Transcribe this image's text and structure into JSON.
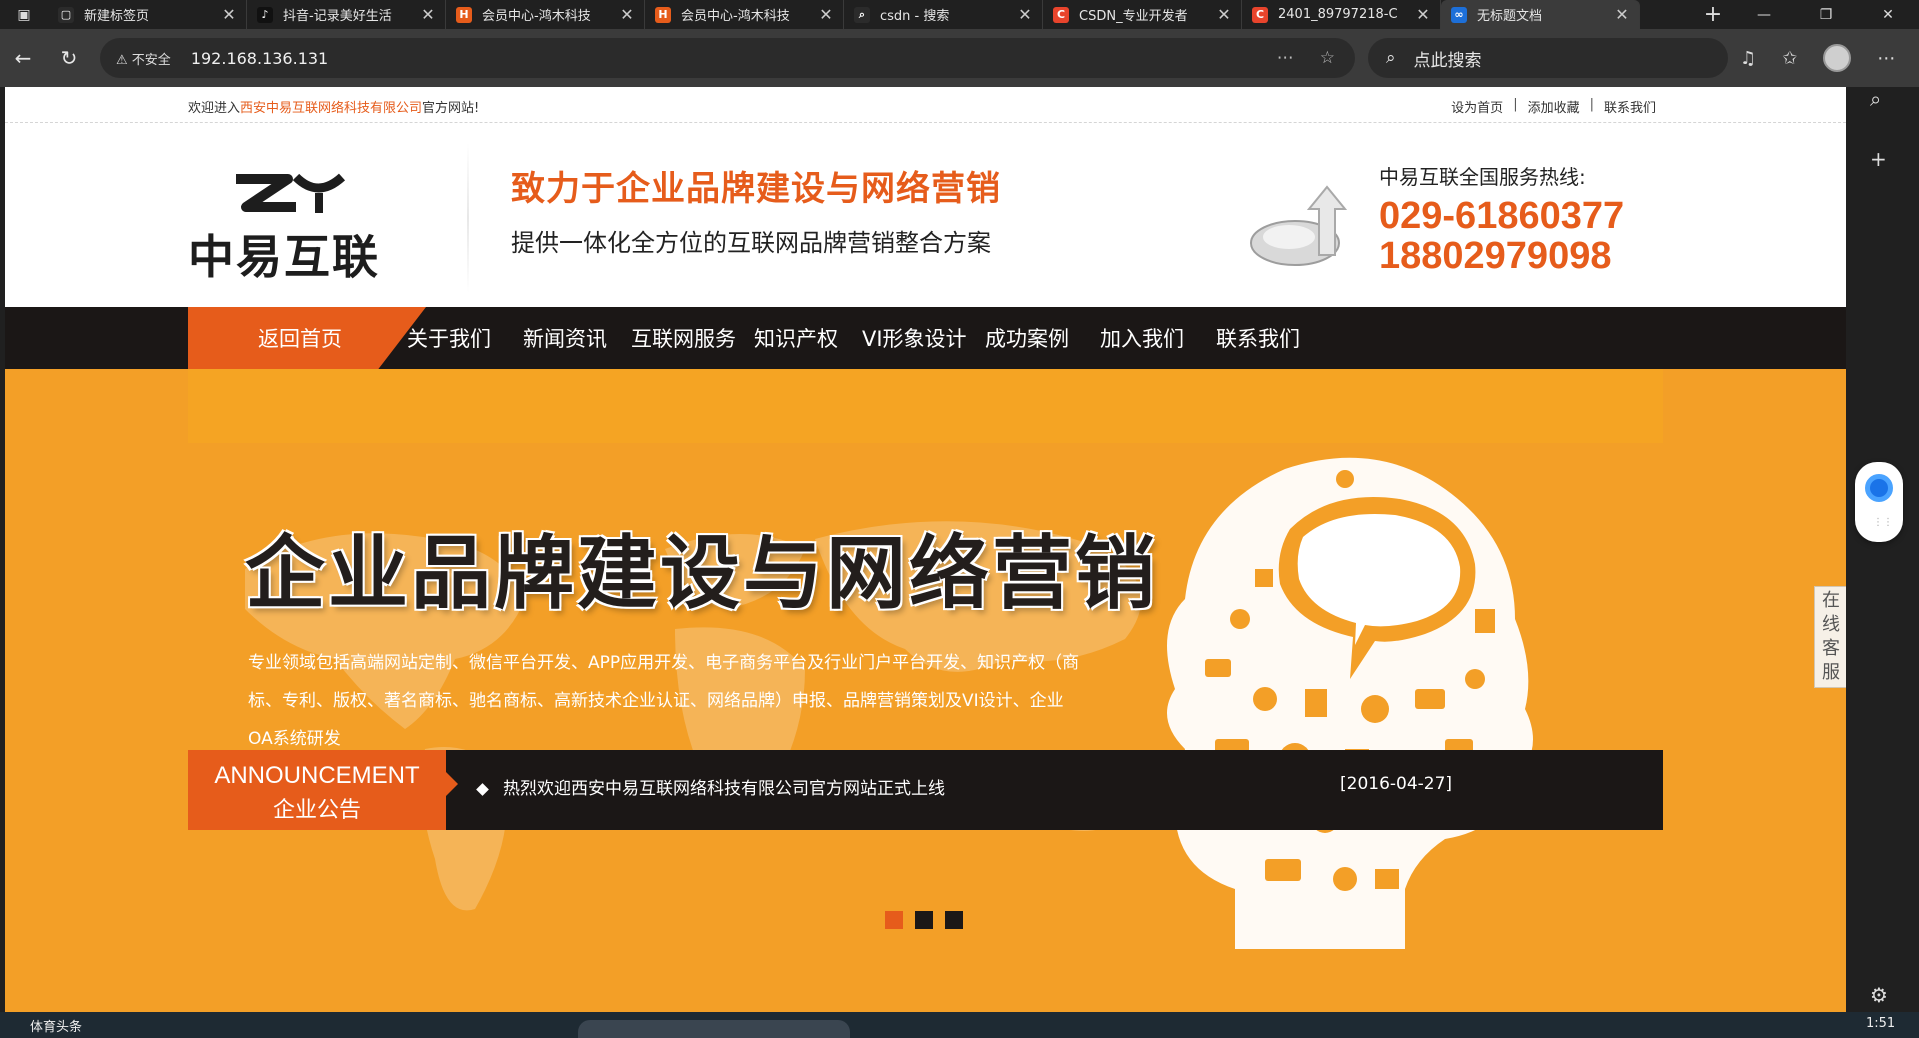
{
  "browser": {
    "tabs": [
      {
        "label": "新建标签页",
        "icon": "new-tab-icon",
        "color": "#2b2b2b",
        "glyph": "▢"
      },
      {
        "label": "抖音-记录美好生活",
        "icon": "douyin-icon",
        "color": "#111111",
        "glyph": "♪"
      },
      {
        "label": "会员中心-鸿木科技",
        "icon": "hongmu-icon",
        "color": "#e65c1b",
        "glyph": "H"
      },
      {
        "label": "会员中心-鸿木科技",
        "icon": "hongmu-icon",
        "color": "#e65c1b",
        "glyph": "H"
      },
      {
        "label": "csdn - 搜索",
        "icon": "bing-search-icon",
        "color": "#2b2b2b",
        "glyph": "⌕"
      },
      {
        "label": "CSDN_专业开发者",
        "icon": "csdn-icon",
        "color": "#e8442c",
        "glyph": "C"
      },
      {
        "label": "2401_89797218-C",
        "icon": "csdn-icon",
        "color": "#e8442c",
        "glyph": "C"
      },
      {
        "label": "无标题文档",
        "icon": "edge-doc-icon",
        "color": "#1d6fd8",
        "glyph": "∞"
      }
    ],
    "url_warning": "不安全",
    "url": "192.168.136.131",
    "search_placeholder": "点此搜索"
  },
  "page": {
    "welcome_prefix": "欢迎进入",
    "welcome_company": "西安中易互联网络科技有限公司",
    "welcome_suffix": "官方网站!",
    "top_links": [
      "设为首页",
      "添加收藏",
      "联系我们"
    ],
    "slogan_main": "致力于企业品牌建设与网络营销",
    "slogan_sub": "提供一体化全方位的互联网品牌营销整合方案",
    "logo_text": "中易互联",
    "hotline_label": "中易互联全国服务热线:",
    "hotline_1": "029-61860377",
    "hotline_2": "18802979098",
    "nav": {
      "home": "返回首页",
      "items": [
        "关于我们",
        "新闻资讯",
        "互联网服务",
        "知识产权",
        "VI形象设计",
        "成功案例",
        "加入我们",
        "联系我们"
      ]
    },
    "banner": {
      "headline": "企业品牌建设与网络营销",
      "description": "专业领域包括高端网站定制、微信平台开发、APP应用开发、电子商务平台及行业门户平台开发、知识产权（商标、专利、版权、著名商标、驰名商标、高新技术企业认证、网络品牌）申报、品牌营销策划及VI设计、企业OA系统研发",
      "slide_count": 3,
      "active_slide": 1
    },
    "announcement": {
      "title_en": "ANNOUNCEMENT",
      "title_zh": "企业公告",
      "item": "热烈欢迎西安中易互联网络科技有限公司官方网站正式上线",
      "date": "[2016-04-27]"
    },
    "online_service": "在线客服"
  },
  "taskbar": {
    "news": "体育头条",
    "time": "1:51"
  },
  "colors": {
    "accent": "#e65c1b",
    "banner": "#f39f27",
    "nav_bg": "#1b1716"
  }
}
